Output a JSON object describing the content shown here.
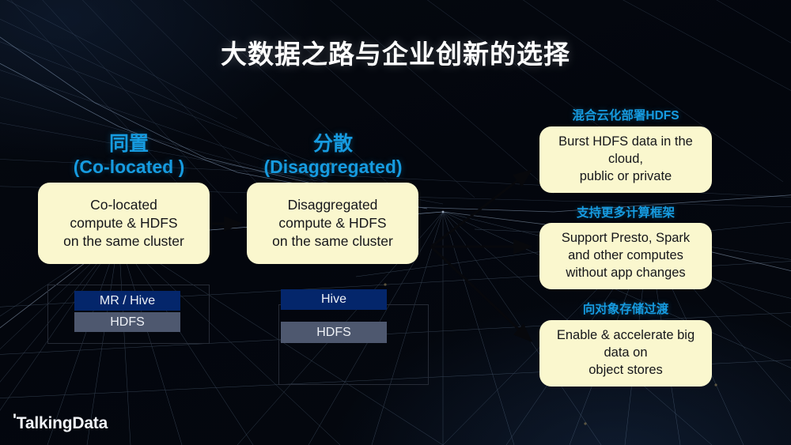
{
  "slide": {
    "title": "大数据之路与企业创新的选择",
    "background_color": "#04070f",
    "accent_color": "#169BE0",
    "box_fill": "#FAF7CE",
    "bar_primary": "#04266B",
    "bar_secondary": "#4E586F"
  },
  "columns": [
    {
      "head_cn": "同置",
      "head_en": "(Co-located )",
      "box_text": "Co-located\ncompute & HDFS\non the same cluster",
      "stack": [
        {
          "label": "MR / Hive",
          "style": "primary"
        },
        {
          "label": "HDFS",
          "style": "secondary"
        }
      ]
    },
    {
      "head_cn": "分散",
      "head_en": "(Disaggregated)",
      "box_text": "Disaggregated\ncompute & HDFS\non the same cluster",
      "stack": [
        {
          "label": "Hive",
          "style": "primary"
        },
        {
          "label": "HDFS",
          "style": "secondary"
        }
      ]
    }
  ],
  "outcomes": [
    {
      "head": "混合云化部署HDFS",
      "body": "Burst HDFS data in the\ncloud,\npublic or private"
    },
    {
      "head": "支持更多计算框架",
      "body": "Support Presto, Spark\nand other computes\nwithout app changes"
    },
    {
      "head": "向对象存储过渡",
      "body": "Enable & accelerate big\ndata on\nobject stores"
    }
  ],
  "logo": {
    "tick": "'",
    "text": "TalkingData"
  }
}
